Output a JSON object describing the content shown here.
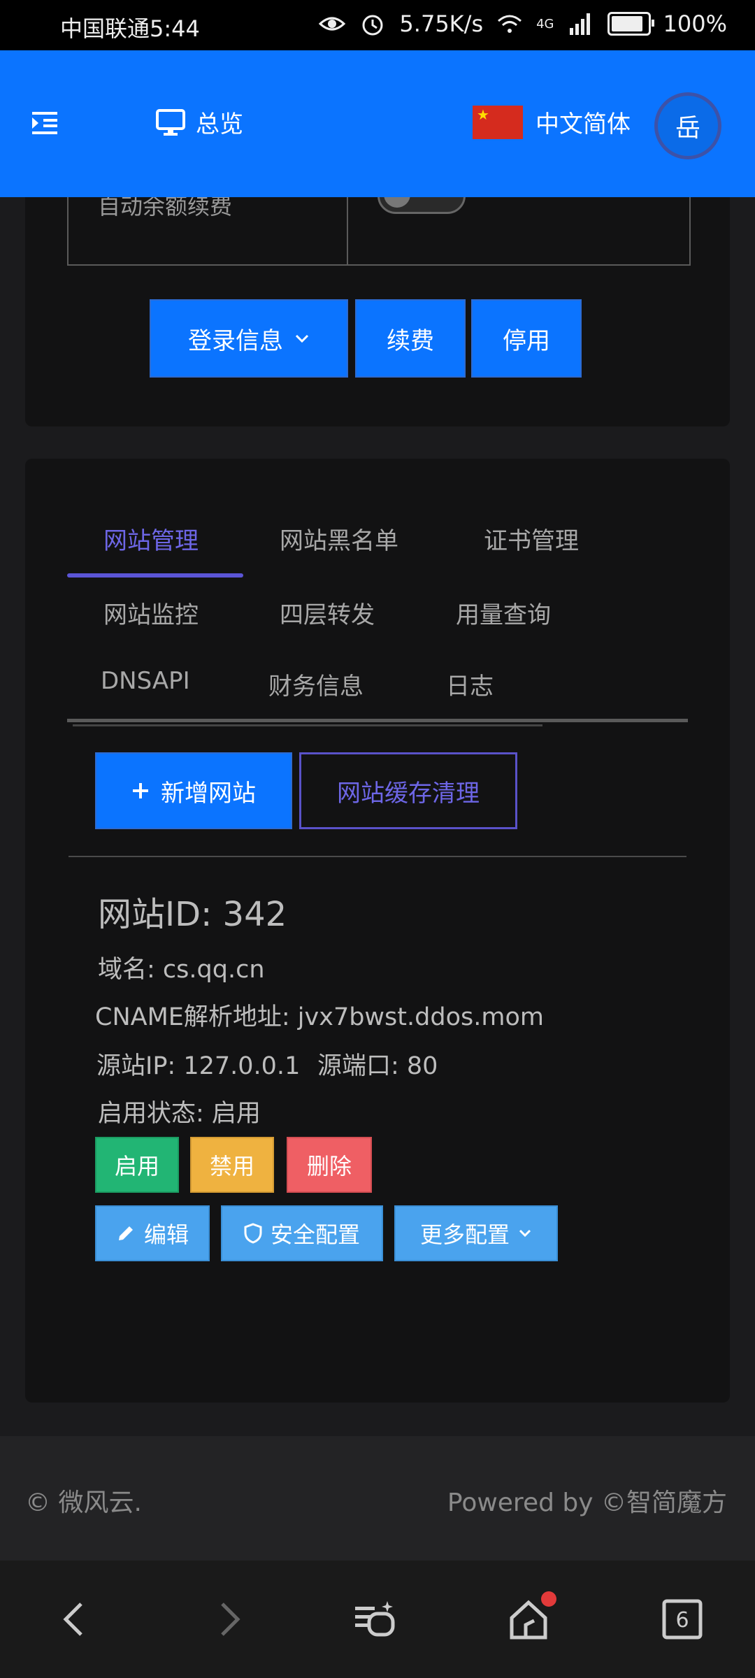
{
  "status_bar": {
    "carrier_time": "中国联通5:44",
    "net_speed": "5.75K/s",
    "network": "4G",
    "battery": "100%",
    "battery_level": 1.0
  },
  "header": {
    "menu_icon": "menu-indent-icon",
    "overview_label": "总览",
    "language_label": "中文简体",
    "avatar_text": "岳"
  },
  "top_card": {
    "auto_renew_label": "自动余额续费",
    "auto_renew_on": false,
    "login_info_label": "登录信息",
    "renew_label": "续费",
    "disable_label": "停用"
  },
  "tabs": [
    {
      "label": "网站管理",
      "active": true
    },
    {
      "label": "网站黑名单",
      "active": false
    },
    {
      "label": "证书管理",
      "active": false
    },
    {
      "label": "网站监控",
      "active": false
    },
    {
      "label": "四层转发",
      "active": false
    },
    {
      "label": "用量查询",
      "active": false
    },
    {
      "label": "DNSAPI",
      "active": false
    },
    {
      "label": "财务信息",
      "active": false
    },
    {
      "label": "日志",
      "active": false
    }
  ],
  "actions": {
    "add_site_label": "新增网站",
    "cache_clear_label": "网站缓存清理"
  },
  "site": {
    "id_line": "网站ID: 342",
    "domain_line": "域名: cs.qq.cn",
    "cname_line": "CNAME解析地址: jvx7bwst.ddos.mom",
    "origin_ip_line": "源站IP: 127.0.0.1",
    "origin_port_line": "源端口: 80",
    "status_line": "启用状态: 启用",
    "enable_label": "启用",
    "ban_label": "禁用",
    "delete_label": "删除",
    "edit_label": "编辑",
    "security_label": "安全配置",
    "more_label": "更多配置"
  },
  "footer": {
    "copyright": "© 微风云.",
    "powered_by": "Powered by ©智简魔方"
  },
  "nav": {
    "badge": true
  },
  "colors": {
    "primary": "#0b74ff",
    "accent": "#5b55d6",
    "success": "#22b574",
    "warning": "#efb240",
    "danger": "#ef5f64",
    "info": "#4aa3ee"
  }
}
